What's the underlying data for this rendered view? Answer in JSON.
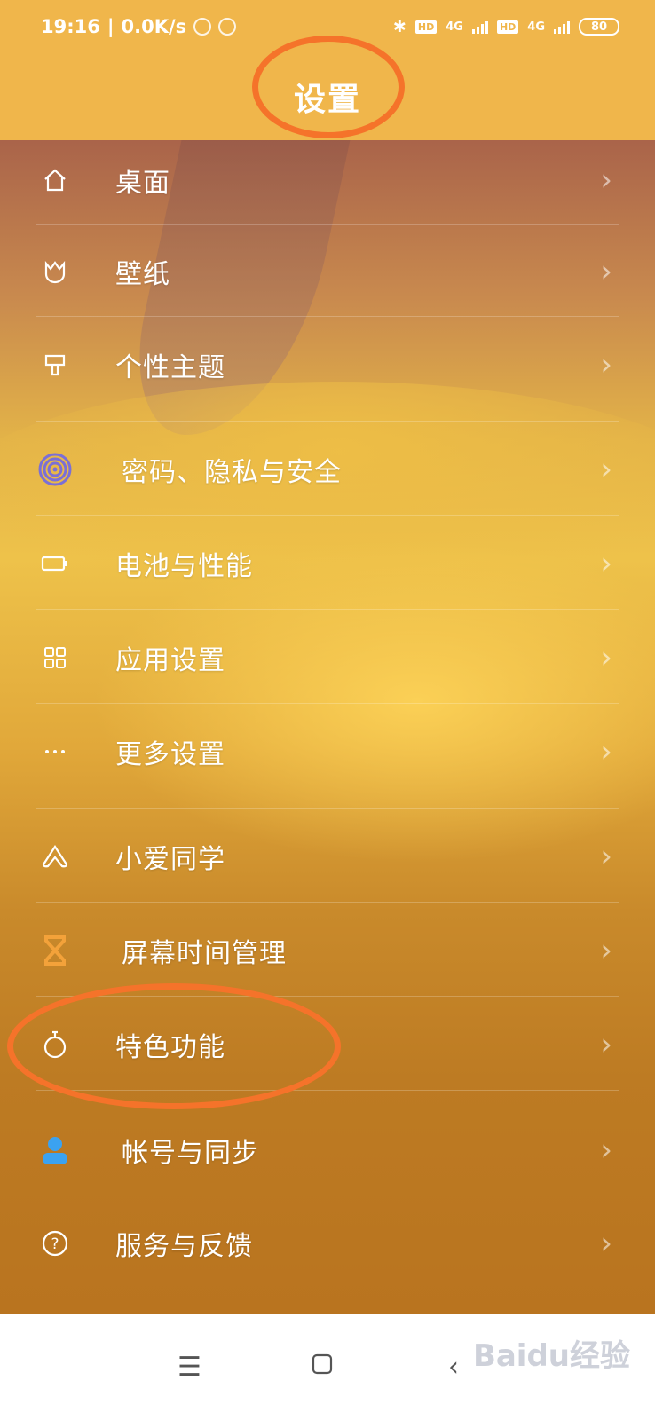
{
  "status_bar": {
    "time": "19:16",
    "net_speed": "0.0K/s",
    "hd1": "HD",
    "hd2": "HD",
    "net1": "4G",
    "net2": "4G",
    "battery": "80"
  },
  "header": {
    "title": "设置"
  },
  "menu": {
    "items": [
      {
        "label": "桌面",
        "icon": "home-icon"
      },
      {
        "label": "壁纸",
        "icon": "wallpaper-icon"
      },
      {
        "label": "个性主题",
        "icon": "theme-brush-icon"
      },
      {
        "label": "密码、隐私与安全",
        "icon": "fingerprint-icon"
      },
      {
        "label": "电池与性能",
        "icon": "battery-icon"
      },
      {
        "label": "应用设置",
        "icon": "apps-grid-icon"
      },
      {
        "label": "更多设置",
        "icon": "more-dots-icon"
      },
      {
        "label": "小爱同学",
        "icon": "xiaoai-icon"
      },
      {
        "label": "屏幕时间管理",
        "icon": "hourglass-icon"
      },
      {
        "label": "特色功能",
        "icon": "stopwatch-icon"
      },
      {
        "label": "帐号与同步",
        "icon": "account-icon"
      },
      {
        "label": "服务与反馈",
        "icon": "help-icon"
      }
    ]
  },
  "colors": {
    "header_bg": "#f0b64b",
    "annotation": "#f5732a",
    "fingerprint": "#7b6fd6",
    "hourglass": "#f3a23a",
    "account": "#3ba2f0"
  },
  "watermark": "Baidu经验"
}
